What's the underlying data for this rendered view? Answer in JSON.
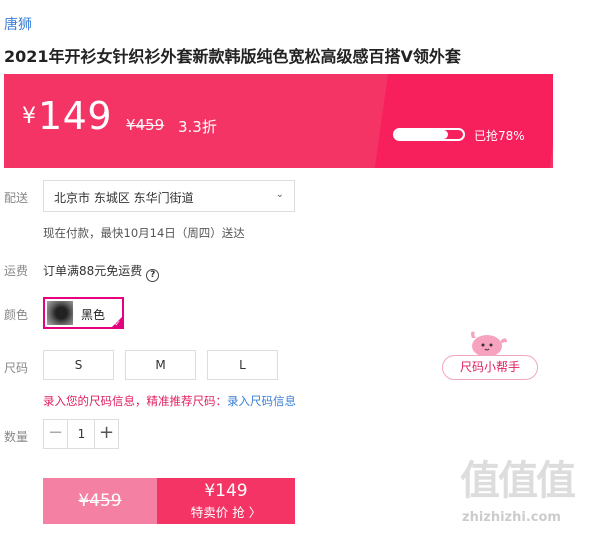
{
  "product": {
    "brand": "唐狮",
    "title": "2021年开衫女针织衫外套新款韩版纯色宽松高级感百搭V领外套"
  },
  "price": {
    "currency": "¥",
    "current": "149",
    "original": "¥459",
    "discount": "3.3折",
    "sold_text": "已抢78%",
    "sold_fraction": 0.78
  },
  "delivery": {
    "label": "配送",
    "address": "北京市 东城区 东华门街道",
    "note": "现在付款，最快10月14日（周四）送达"
  },
  "shipping": {
    "label": "运费",
    "text": "订单满88元免运费",
    "help": "?"
  },
  "color": {
    "label": "颜色",
    "options": [
      {
        "name": "黑色",
        "selected": true
      }
    ]
  },
  "size": {
    "label": "尺码",
    "options": [
      "S",
      "M",
      "L"
    ],
    "helper": "尺码小帮手",
    "info_text": "录入您的尺码信息，精准推荐尺码：",
    "info_link": "录入尺码信息"
  },
  "quantity": {
    "label": "数量",
    "value": "1",
    "minus": "−",
    "plus": "+"
  },
  "buy": {
    "original": "¥459",
    "price": "¥149",
    "action": "特卖价 抢 〉"
  },
  "watermark": {
    "glyphs": "值值值",
    "url": "zhizhizhi.com"
  },
  "colors": {
    "accent": "#f43465",
    "accent_light": "#f481a3",
    "link": "#3a7fd5",
    "highlight": "#e02060"
  }
}
